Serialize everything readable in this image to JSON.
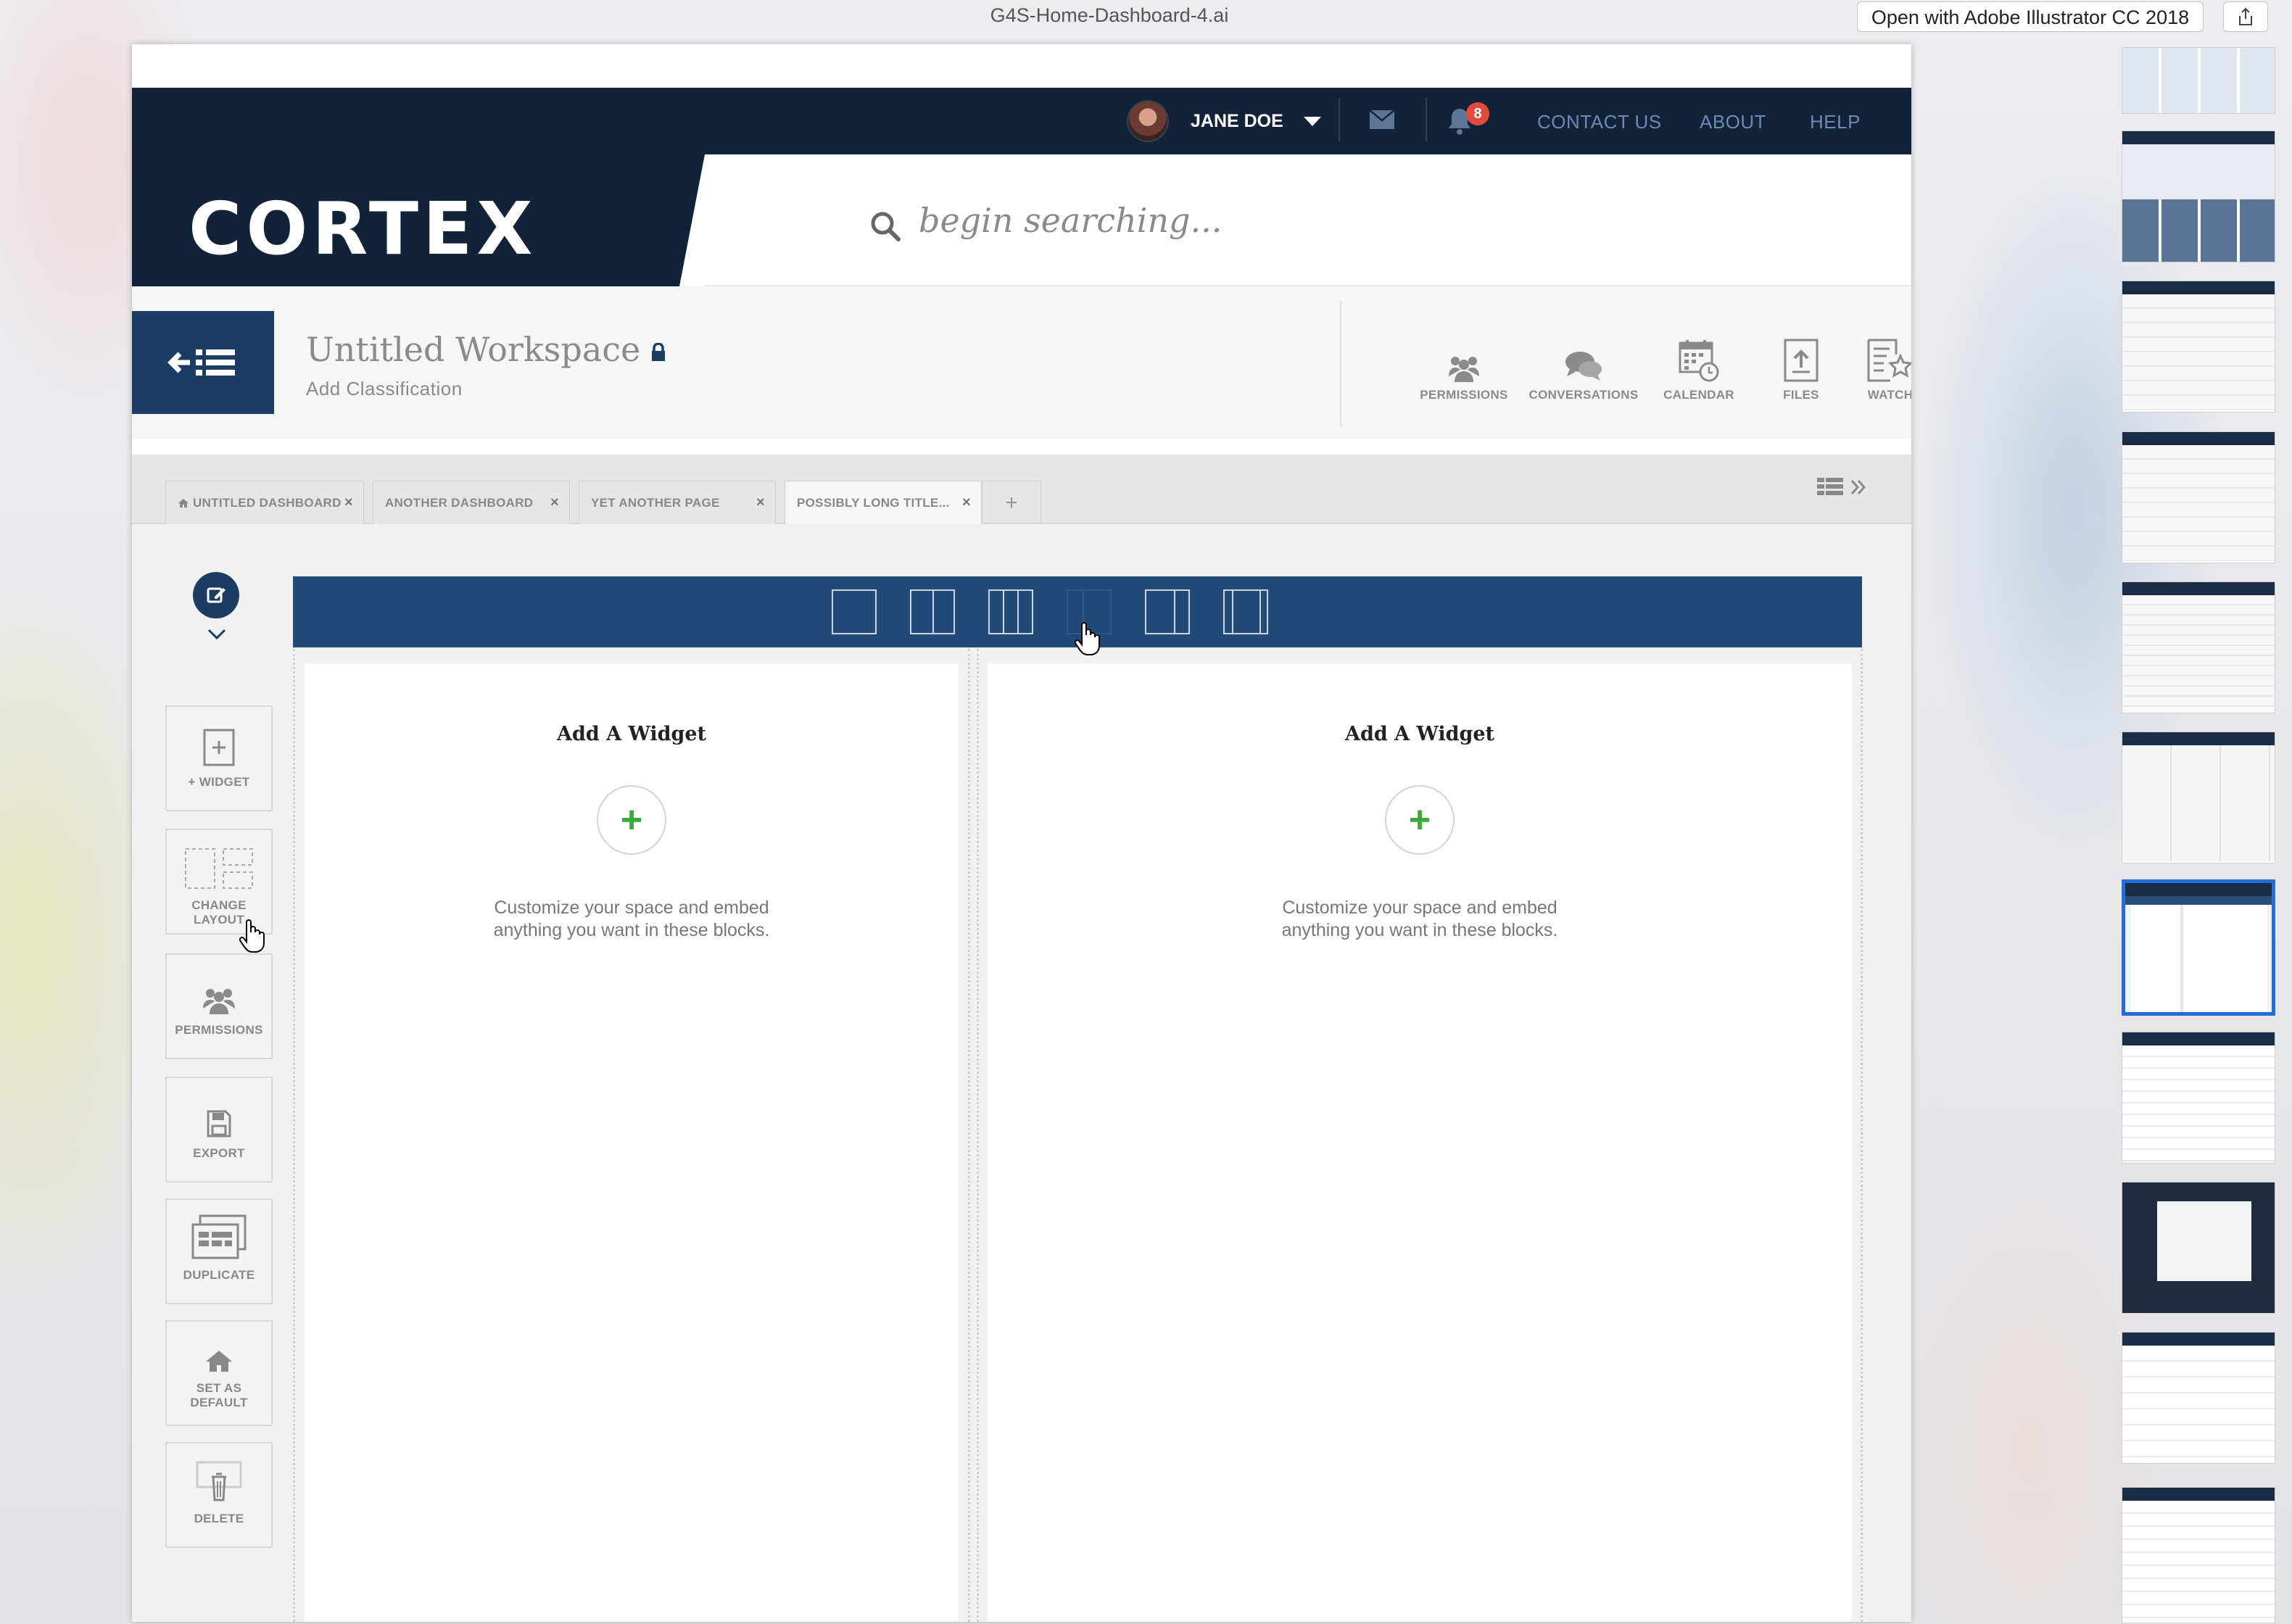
{
  "window": {
    "title": "G4S-Home-Dashboard-4.ai",
    "open_with_label": "Open with Adobe Illustrator CC 2018"
  },
  "topbar": {
    "user_name": "JANE DOE",
    "notification_count": "8",
    "links": [
      "CONTACT US",
      "ABOUT",
      "HELP"
    ]
  },
  "brand": {
    "logo": "CORTEX"
  },
  "search": {
    "placeholder": "begin searching..."
  },
  "workspace": {
    "title": "Untitled Workspace",
    "subtitle": "Add Classification",
    "actions": [
      "PERMISSIONS",
      "CONVERSATIONS",
      "CALENDAR",
      "FILES",
      "WATCH"
    ]
  },
  "tabs": [
    {
      "label": "UNTITLED DASHBOARD"
    },
    {
      "label": "ANOTHER DASHBOARD"
    },
    {
      "label": "YET ANOTHER PAGE"
    },
    {
      "label": "POSSIBLY LONG TITLE..."
    }
  ],
  "sidebar": {
    "widget": "+ WIDGET",
    "change_layout_1": "CHANGE",
    "change_layout_2": "LAYOUT",
    "permissions": "PERMISSIONS",
    "export": "EXPORT",
    "duplicate": "DUPLICATE",
    "set_default_1": "SET AS",
    "set_default_2": "DEFAULT",
    "delete": "DELETE"
  },
  "widgets": [
    {
      "title": "Add A Widget",
      "desc_1": "Customize your space and embed",
      "desc_2": "anything you want in these blocks."
    },
    {
      "title": "Add A Widget",
      "desc_1": "Customize your space and embed",
      "desc_2": "anything you want in these blocks."
    }
  ],
  "colors": {
    "navy": "#122238",
    "accent_blue": "#224a77",
    "notification": "#e24a3b",
    "add_green": "#3aa83a",
    "selected_thumb": "#1f6fd6"
  },
  "icons": [
    "search-icon",
    "mail-icon",
    "bell-icon",
    "lock-icon",
    "back-list-icon",
    "users-icon",
    "chat-icon",
    "calendar-icon",
    "upload-icon",
    "watch-icon",
    "plus-icon",
    "save-icon",
    "copy-icon",
    "home-icon",
    "trash-icon",
    "edit-icon"
  ]
}
